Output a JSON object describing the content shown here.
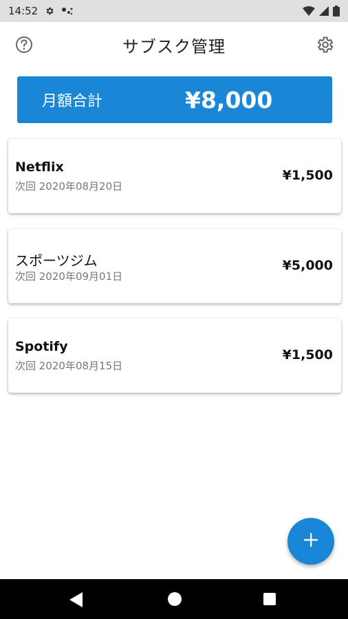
{
  "status_bar": {
    "time": "14:52"
  },
  "app_bar": {
    "title": "サブスク管理"
  },
  "total": {
    "label": "月額合計",
    "amount": "¥8,000"
  },
  "subscriptions": [
    {
      "name": "Netflix",
      "next": "次回 2020年08月20日",
      "price": "¥1,500"
    },
    {
      "name": "スポーツジム",
      "next": "次回 2020年09月01日",
      "price": "¥5,000"
    },
    {
      "name": "Spotify",
      "next": "次回 2020年08月15日",
      "price": "¥1,500"
    }
  ],
  "colors": {
    "accent": "#1a86d6",
    "status_bar": "#e0e0e0",
    "nav_bar": "#000000"
  },
  "icons": [
    "settings-icon",
    "help-icon",
    "add-icon",
    "wifi-icon",
    "signal-icon",
    "battery-icon"
  ]
}
